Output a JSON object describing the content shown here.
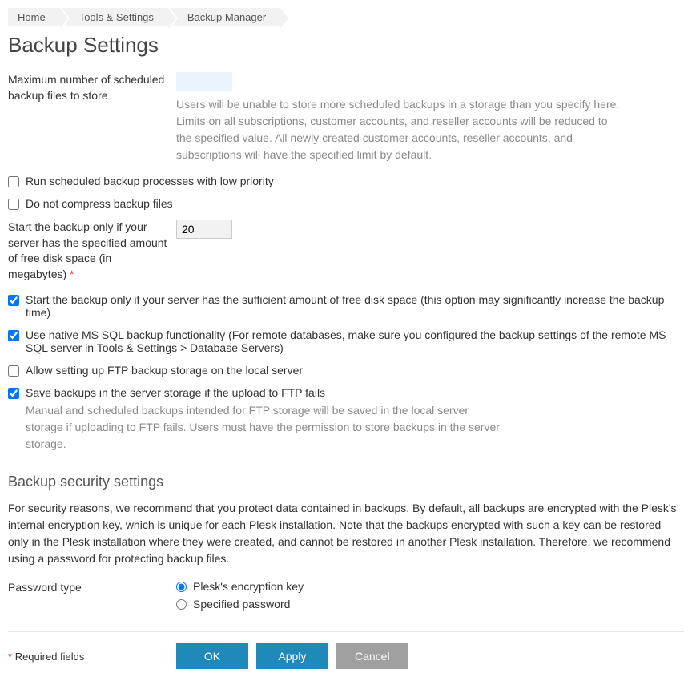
{
  "breadcrumbs": [
    "Home",
    "Tools & Settings",
    "Backup Manager"
  ],
  "page_title": "Backup Settings",
  "fields": {
    "max_backups": {
      "label": "Maximum number of scheduled backup files to store",
      "value": "",
      "help": "Users will be unable to store more scheduled backups in a storage than you specify here. Limits on all subscriptions, customer accounts, and reseller accounts will be reduced to the specified value. All newly created customer accounts, reseller accounts, and subscriptions will have the specified limit by default."
    },
    "low_priority": {
      "label": "Run scheduled backup processes with low priority",
      "checked": false
    },
    "no_compress": {
      "label": "Do not compress backup files",
      "checked": false
    },
    "free_space_mb": {
      "label": "Start the backup only if your server has the specified amount of free disk space (in megabytes)",
      "value": "20"
    },
    "sufficient_space": {
      "label": "Start the backup only if your server has the sufficient amount of free disk space (this option may significantly increase the backup time)",
      "checked": true
    },
    "native_mssql": {
      "label": "Use native MS SQL backup functionality (For remote databases, make sure you configured the backup settings of the remote MS SQL server in Tools & Settings > Database Servers)",
      "checked": true
    },
    "ftp_local": {
      "label": "Allow setting up FTP backup storage on the local server",
      "checked": false
    },
    "save_if_ftp_fail": {
      "label": "Save backups in the server storage if the upload to FTP fails",
      "checked": true,
      "help": "Manual and scheduled backups intended for FTP storage will be saved in the local server storage if uploading to FTP fails. Users must have the permission to store backups in the server storage."
    }
  },
  "security": {
    "title": "Backup security settings",
    "desc": "For security reasons, we recommend that you protect data contained in backups. By default, all backups are encrypted with the Plesk's internal encryption key, which is unique for each Plesk installation. Note that the backups encrypted with such a key can be restored only in the Plesk installation where they were created, and cannot be restored in another Plesk installation. Therefore, we recommend using a password for protecting backup files.",
    "password_type_label": "Password type",
    "options": {
      "plesk_key": "Plesk's encryption key",
      "specified": "Specified password"
    },
    "selected": "plesk_key"
  },
  "footer": {
    "required_label": "Required fields",
    "ok": "OK",
    "apply": "Apply",
    "cancel": "Cancel"
  }
}
